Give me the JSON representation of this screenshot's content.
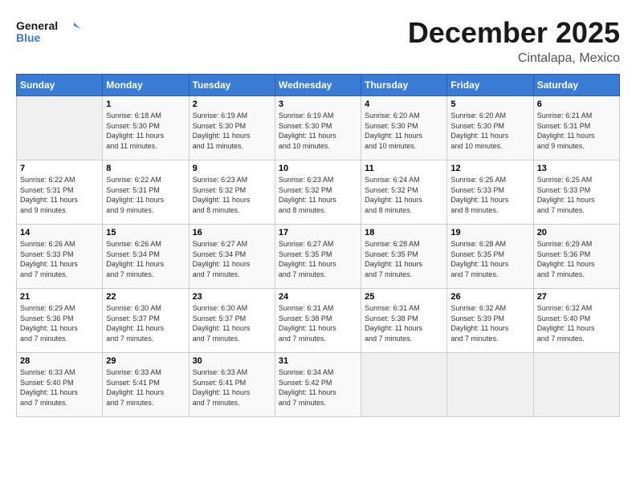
{
  "header": {
    "logo_line1": "General",
    "logo_line2": "Blue",
    "month": "December 2025",
    "location": "Cintalapa, Mexico"
  },
  "days_of_week": [
    "Sunday",
    "Monday",
    "Tuesday",
    "Wednesday",
    "Thursday",
    "Friday",
    "Saturday"
  ],
  "weeks": [
    [
      {
        "num": "",
        "info": ""
      },
      {
        "num": "1",
        "info": "Sunrise: 6:18 AM\nSunset: 5:30 PM\nDaylight: 11 hours\nand 11 minutes."
      },
      {
        "num": "2",
        "info": "Sunrise: 6:19 AM\nSunset: 5:30 PM\nDaylight: 11 hours\nand 11 minutes."
      },
      {
        "num": "3",
        "info": "Sunrise: 6:19 AM\nSunset: 5:30 PM\nDaylight: 11 hours\nand 10 minutes."
      },
      {
        "num": "4",
        "info": "Sunrise: 6:20 AM\nSunset: 5:30 PM\nDaylight: 11 hours\nand 10 minutes."
      },
      {
        "num": "5",
        "info": "Sunrise: 6:20 AM\nSunset: 5:30 PM\nDaylight: 11 hours\nand 10 minutes."
      },
      {
        "num": "6",
        "info": "Sunrise: 6:21 AM\nSunset: 5:31 PM\nDaylight: 11 hours\nand 9 minutes."
      }
    ],
    [
      {
        "num": "7",
        "info": "Sunrise: 6:22 AM\nSunset: 5:31 PM\nDaylight: 11 hours\nand 9 minutes."
      },
      {
        "num": "8",
        "info": "Sunrise: 6:22 AM\nSunset: 5:31 PM\nDaylight: 11 hours\nand 9 minutes."
      },
      {
        "num": "9",
        "info": "Sunrise: 6:23 AM\nSunset: 5:32 PM\nDaylight: 11 hours\nand 8 minutes."
      },
      {
        "num": "10",
        "info": "Sunrise: 6:23 AM\nSunset: 5:32 PM\nDaylight: 11 hours\nand 8 minutes."
      },
      {
        "num": "11",
        "info": "Sunrise: 6:24 AM\nSunset: 5:32 PM\nDaylight: 11 hours\nand 8 minutes."
      },
      {
        "num": "12",
        "info": "Sunrise: 6:25 AM\nSunset: 5:33 PM\nDaylight: 11 hours\nand 8 minutes."
      },
      {
        "num": "13",
        "info": "Sunrise: 6:25 AM\nSunset: 5:33 PM\nDaylight: 11 hours\nand 7 minutes."
      }
    ],
    [
      {
        "num": "14",
        "info": "Sunrise: 6:26 AM\nSunset: 5:33 PM\nDaylight: 11 hours\nand 7 minutes."
      },
      {
        "num": "15",
        "info": "Sunrise: 6:26 AM\nSunset: 5:34 PM\nDaylight: 11 hours\nand 7 minutes."
      },
      {
        "num": "16",
        "info": "Sunrise: 6:27 AM\nSunset: 5:34 PM\nDaylight: 11 hours\nand 7 minutes."
      },
      {
        "num": "17",
        "info": "Sunrise: 6:27 AM\nSunset: 5:35 PM\nDaylight: 11 hours\nand 7 minutes."
      },
      {
        "num": "18",
        "info": "Sunrise: 6:28 AM\nSunset: 5:35 PM\nDaylight: 11 hours\nand 7 minutes."
      },
      {
        "num": "19",
        "info": "Sunrise: 6:28 AM\nSunset: 5:35 PM\nDaylight: 11 hours\nand 7 minutes."
      },
      {
        "num": "20",
        "info": "Sunrise: 6:29 AM\nSunset: 5:36 PM\nDaylight: 11 hours\nand 7 minutes."
      }
    ],
    [
      {
        "num": "21",
        "info": "Sunrise: 6:29 AM\nSunset: 5:36 PM\nDaylight: 11 hours\nand 7 minutes."
      },
      {
        "num": "22",
        "info": "Sunrise: 6:30 AM\nSunset: 5:37 PM\nDaylight: 11 hours\nand 7 minutes."
      },
      {
        "num": "23",
        "info": "Sunrise: 6:30 AM\nSunset: 5:37 PM\nDaylight: 11 hours\nand 7 minutes."
      },
      {
        "num": "24",
        "info": "Sunrise: 6:31 AM\nSunset: 5:38 PM\nDaylight: 11 hours\nand 7 minutes."
      },
      {
        "num": "25",
        "info": "Sunrise: 6:31 AM\nSunset: 5:38 PM\nDaylight: 11 hours\nand 7 minutes."
      },
      {
        "num": "26",
        "info": "Sunrise: 6:32 AM\nSunset: 5:39 PM\nDaylight: 11 hours\nand 7 minutes."
      },
      {
        "num": "27",
        "info": "Sunrise: 6:32 AM\nSunset: 5:40 PM\nDaylight: 11 hours\nand 7 minutes."
      }
    ],
    [
      {
        "num": "28",
        "info": "Sunrise: 6:33 AM\nSunset: 5:40 PM\nDaylight: 11 hours\nand 7 minutes."
      },
      {
        "num": "29",
        "info": "Sunrise: 6:33 AM\nSunset: 5:41 PM\nDaylight: 11 hours\nand 7 minutes."
      },
      {
        "num": "30",
        "info": "Sunrise: 6:33 AM\nSunset: 5:41 PM\nDaylight: 11 hours\nand 7 minutes."
      },
      {
        "num": "31",
        "info": "Sunrise: 6:34 AM\nSunset: 5:42 PM\nDaylight: 11 hours\nand 7 minutes."
      },
      {
        "num": "",
        "info": ""
      },
      {
        "num": "",
        "info": ""
      },
      {
        "num": "",
        "info": ""
      }
    ]
  ]
}
